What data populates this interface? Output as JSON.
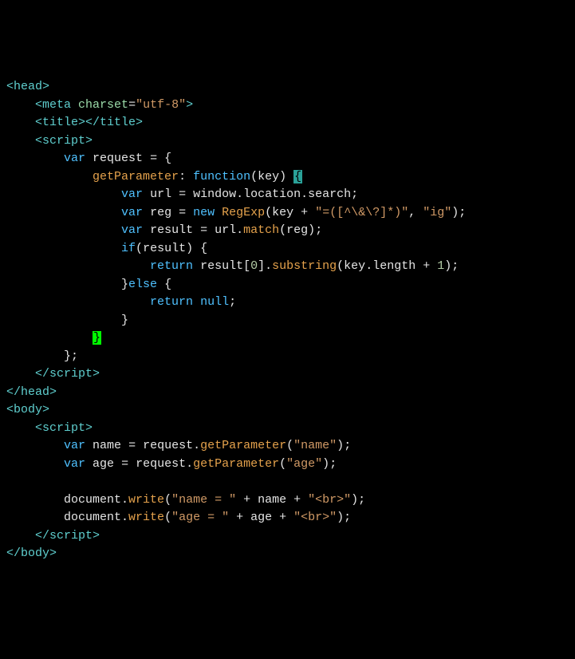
{
  "lines": {
    "l1": {
      "tag_open": "<head>"
    },
    "l2": {
      "tag_open": "<meta",
      "attr_name": "charset",
      "eq": "=",
      "attr_val": "\"utf-8\"",
      "tag_close": ">"
    },
    "l3": {
      "open": "<title>",
      "close": "</title>"
    },
    "l4": {
      "tag": "<script>"
    },
    "l5": {
      "var": "var",
      "name": "request",
      "eq": " = ",
      "brace": "{"
    },
    "l6": {
      "prop": "getParameter",
      "colon": ": ",
      "fn": "function",
      "paren_o": "(",
      "arg": "key",
      "paren_c": ") ",
      "brace_hl": "{"
    },
    "l7": {
      "var": "var",
      "name": "url",
      "eq": " = ",
      "obj": "window",
      "d1": ".",
      "p1": "location",
      "d2": ".",
      "p2": "search",
      "semi": ";"
    },
    "l8": {
      "var": "var",
      "name": "reg",
      "eq": " = ",
      "new": "new",
      "ctor": "RegExp",
      "po": "(",
      "arg": "key",
      "plus": " + ",
      "str1": "\"=([^\\&\\?]*)\"",
      "comma": ", ",
      "str2": "\"ig\"",
      "pc": ")",
      "semi": ";"
    },
    "l9": {
      "var": "var",
      "name": "result",
      "eq": " = ",
      "obj": "url",
      "dot": ".",
      "method": "match",
      "po": "(",
      "arg": "reg",
      "pc": ")",
      "semi": ";"
    },
    "l10": {
      "if": "if",
      "po": "(",
      "arg": "result",
      "pc": ") ",
      "brace": "{"
    },
    "l11": {
      "ret": "return",
      "sp": " ",
      "obj": "result",
      "br_o": "[",
      "idx": "0",
      "br_c": "]",
      "dot": ".",
      "method": "substring",
      "po": "(",
      "arg": "key",
      "dot2": ".",
      "prop": "length",
      "plus": " + ",
      "num": "1",
      "pc": ")",
      "semi": ";"
    },
    "l12": {
      "brace": "}",
      "else": "else",
      "brace2": " {"
    },
    "l13": {
      "ret": "return",
      "sp": " ",
      "null": "null",
      "semi": ";"
    },
    "l14": {
      "brace": "}"
    },
    "l15": {
      "brace_hl": "}"
    },
    "l16": {
      "brace": "}",
      "semi": ";"
    },
    "l17": {
      "tag": "</scr"
    },
    "l17b": {
      "tag": "ipt>"
    },
    "l18": {
      "tag": "</head>"
    },
    "l19": {
      "tag": "<body>"
    },
    "l20": {
      "tag": "<script>"
    },
    "l21": {
      "var": "var",
      "name": "name",
      "eq": " = ",
      "obj": "request",
      "dot": ".",
      "method": "getParameter",
      "po": "(",
      "str": "\"name\"",
      "pc": ")",
      "semi": ";"
    },
    "l22": {
      "var": "var",
      "name": "age",
      "eq": " = ",
      "obj": "request",
      "dot": ".",
      "method": "getParameter",
      "po": "(",
      "str": "\"age\"",
      "pc": ")",
      "semi": ";"
    },
    "l23": {
      "obj": "document",
      "dot": ".",
      "method": "write",
      "po": "(",
      "str1": "\"name = \"",
      "plus1": " + ",
      "arg": "name",
      "plus2": " + ",
      "str2": "\"<br>\"",
      "pc": ")",
      "semi": ";"
    },
    "l24": {
      "obj": "document",
      "dot": ".",
      "method": "write",
      "po": "(",
      "str1": "\"age = \"",
      "plus1": " + ",
      "arg": "age",
      "plus2": " + ",
      "str2": "\"<br>\"",
      "pc": ")",
      "semi": ";"
    },
    "l25": {
      "tag": "</scr"
    },
    "l25b": {
      "tag": "ipt>"
    },
    "l26": {
      "tag": "</body>"
    }
  }
}
